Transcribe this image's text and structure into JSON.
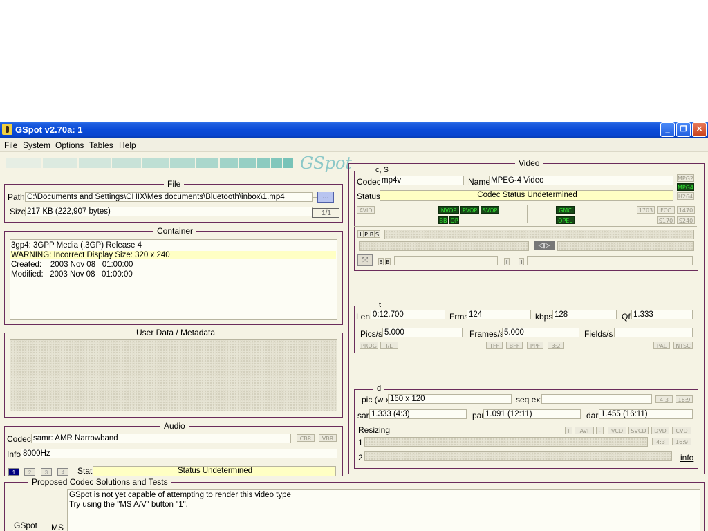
{
  "window": {
    "title": "GSpot v2.70a: 1",
    "minimize": "_",
    "restore": "❐",
    "close": "✕"
  },
  "menu": [
    "File",
    "System",
    "Options",
    "Tables",
    "Help"
  ],
  "logo": "GSpot",
  "file": {
    "legend": "File",
    "path_label": "Path",
    "path_value": "C:\\Documents and Settings\\CHIX\\Mes documents\\Bluetooth\\inbox\\1.mp4",
    "browse_label": "...",
    "size_label": "Size",
    "size_value": "217 KB (222,907 bytes)",
    "page_indicator": "1/1"
  },
  "container": {
    "legend": "Container",
    "lines": [
      "3gp4: 3GPP Media (.3GP) Release 4",
      "WARNING: Incorrect Display Size: 320 x 240",
      "Created:    2003 Nov 08   01:00:00",
      "Modified:   2003 Nov 08   01:00:00"
    ]
  },
  "metadata": {
    "legend": "User Data / Metadata"
  },
  "audio": {
    "legend": "Audio",
    "codec_label": "Codec",
    "codec_value": "samr: AMR Narrowband",
    "cbr": "CBR",
    "vbr": "VBR",
    "info_label": "Info",
    "info_value": "8000Hz",
    "stream_tabs": [
      "1",
      "2",
      "3",
      "4"
    ],
    "stat_label": "Stat",
    "stat_value": "Status Undetermined"
  },
  "video": {
    "legend": "Video",
    "cs_legend": "c, S",
    "codec_label": "Codec",
    "codec_value": "mp4v",
    "name_label": "Name",
    "name_value": "MPEG-4 Video",
    "status_label": "Status",
    "status_value": "Codec Status Undetermined",
    "right_tags": [
      "MPG2",
      "MPG4",
      "H264"
    ],
    "avid": "AVID",
    "vop_tags": [
      "NVOP",
      "PVOP",
      "SVOP"
    ],
    "vop_tags2": [
      "BB",
      "QP"
    ],
    "mid_tags": [
      "GMC",
      "QPEL"
    ],
    "iso_tags": [
      "1703",
      "FCC",
      "1470",
      "S170",
      "S240"
    ],
    "frame_tags": [
      "I",
      "P",
      "B",
      "S"
    ],
    "bb_tags": [
      "B",
      "B"
    ],
    "ii_tags": [
      "I",
      "I"
    ],
    "t_legend": "t",
    "len_label": "Len",
    "len_value": "0:12.700",
    "frms_label": "Frms",
    "frms_value": "124",
    "kbps_label": "kbps",
    "kbps_value": "128",
    "qf_label": "Qf",
    "qf_value": "1.333",
    "pics_label": "Pics/s",
    "pics_value": "5.000",
    "frames_label": "Frames/s",
    "frames_value": "5.000",
    "fields_label": "Fields/s",
    "fields_value": "",
    "scan_tags": [
      "PROG",
      "I/L"
    ],
    "field_tags": [
      "TFF",
      "BFF",
      "PPF",
      "3:2"
    ],
    "std_tags": [
      "PAL",
      "NTSC"
    ],
    "d_legend": "d",
    "pic_label": "pic (w x h)",
    "pic_value": "160 x 120",
    "seqext_label": "seq ext",
    "seqext_value": "",
    "ar_tags": [
      "4:3",
      "16:9"
    ],
    "sar_label": "sar",
    "sar_value": "1.333 (4:3)",
    "par_label": "par",
    "par_value": "1.091 (12:11)",
    "dar_label": "dar",
    "dar_value": "1.455 (16:11)",
    "resizing_label": "Resizing",
    "resize_tags": [
      "+",
      "AVI",
      "-",
      "VCD",
      "SVCD",
      "DVD",
      "CVD"
    ],
    "row1_label": "1",
    "row2_label": "2",
    "ar_tags2": [
      "4:3",
      "16:9"
    ],
    "info_link": "info"
  },
  "proposed": {
    "legend": "Proposed Codec Solutions and Tests",
    "gspot_label": "GSpot",
    "ms_label": "MS",
    "lines": [
      "GSpot is not yet capable of attempting to render this video type",
      "Try using the \"MS A/V\" button \"1\"."
    ]
  }
}
